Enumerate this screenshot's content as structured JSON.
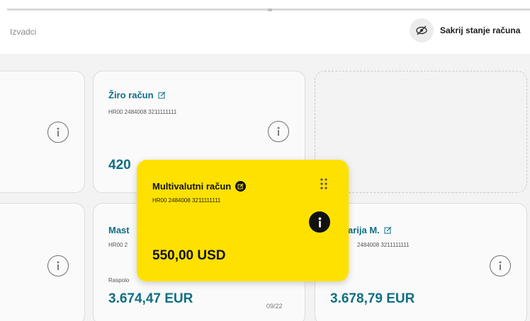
{
  "header": {
    "nav_label": "Izvadci",
    "toggle_label": "Sakrij stanje računa",
    "toggle_icon": "eye-off-icon"
  },
  "cards": [
    {
      "title": "Žiro račun",
      "iban": "HR00 2484008 3211111111",
      "amount_partial": "420"
    },
    {
      "title_partial": "Mast",
      "iban_partial": "HR00 2",
      "label_partial": "Raspolo",
      "amount": "3.674,47 EUR",
      "date": "09/22"
    },
    {
      "title_partial": "arija M.",
      "iban_partial": "2484008 3211111111",
      "amount": "3.678,79 EUR"
    }
  ],
  "drag_card": {
    "title": "Multivalutni račun",
    "iban": "HR00 2484008 3211111111",
    "amount": "550,00 USD",
    "background": "#ffe100"
  },
  "colors": {
    "accent": "#0f6e84",
    "highlight": "#ffe100"
  }
}
